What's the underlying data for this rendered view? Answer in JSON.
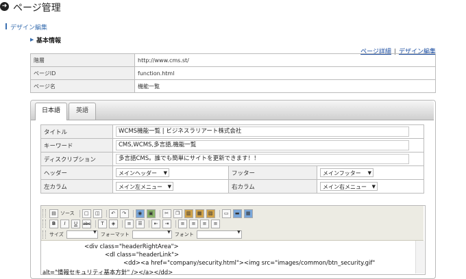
{
  "header": {
    "icon": "arrow-right-circle-icon",
    "icon_glyph": "➜",
    "title": "ページ管理"
  },
  "section": {
    "title": "デザイン編集"
  },
  "subsection": {
    "arrow": "▶",
    "title": "基本情報"
  },
  "links": {
    "page_detail": "ページ詳細",
    "separator": "|",
    "design_edit": "デザイン編集"
  },
  "info_rows": [
    {
      "label": "階層",
      "value": "http://www.cms.st/"
    },
    {
      "label": "ページID",
      "value": "function.html"
    },
    {
      "label": "ページ名",
      "value": "機能一覧"
    }
  ],
  "tabs": [
    {
      "label": "日本語",
      "active": true
    },
    {
      "label": "英語",
      "active": false
    }
  ],
  "form": {
    "title_label": "タイトル",
    "title_value": "WCMS機能一覧 | ビジネスラリアート株式会社",
    "keyword_label": "キーワード",
    "keyword_value": "CMS,WCMS,多言語,機能一覧",
    "desc_label": "ディスクリプション",
    "desc_value": "多言語CMS。誰でも簡単にサイトを更新できます！！",
    "header_label": "ヘッダー",
    "header_select": "メインヘッダー",
    "footer_label": "フッター",
    "footer_select": "メインフッター",
    "left_label": "左カラム",
    "left_select": "メイン左メニュー",
    "right_label": "右カラム",
    "right_select": "メイン右メニュー"
  },
  "editor": {
    "source_label": "ソース",
    "size_label": "サイズ",
    "format_label": "フォーマット",
    "font_label": "フォント",
    "code_lines": [
      "<div class=\"headerRightArea\">",
      "<dl class=\"headerLink\">",
      "<dd><a href=\"company/security.html\"><img src=\"images/common/btn_security.gif\"",
      "alt=\"情報セキュリティ基本方針\" /></a></dd>"
    ]
  },
  "colors": {
    "accent": "#3a6fb0",
    "link": "#1a4ca0"
  }
}
